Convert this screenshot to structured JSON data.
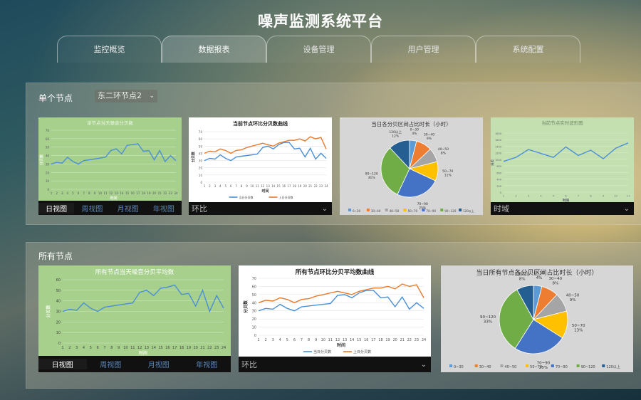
{
  "app": {
    "title": "噪声监测系统平台"
  },
  "tabs": [
    "监控概览",
    "数据报表",
    "设备管理",
    "用户管理",
    "系统配置"
  ],
  "active_tab": 1,
  "single": {
    "heading": "单个节点",
    "select_value": "东二环节点2",
    "charts": {
      "daily": {
        "title": "单节点当天噪音分贝数",
        "xlabel": "时间",
        "ylabel": "分贝数"
      },
      "compare": {
        "title": "当前节点环比分贝数曲线",
        "xlabel": "时间",
        "ylabel": "分贝数",
        "legend": [
          "当日分贝数",
          "上日分贝数"
        ],
        "footer": "环比"
      },
      "pie": {
        "title": "当日各分贝区间占比时长（小时）"
      },
      "wave": {
        "title": "当前节点实时波形图",
        "xlabel": "时间",
        "ylabel": "分贝",
        "footer": "时域"
      }
    },
    "views": [
      "日视图",
      "周视图",
      "月视图",
      "年视图"
    ]
  },
  "all": {
    "heading": "所有节点",
    "charts": {
      "daily": {
        "title": "所有节点当天噪音分贝平均数",
        "xlabel": "时间",
        "ylabel": "分贝数"
      },
      "compare": {
        "title": "所有节点环比分贝平均数曲线",
        "xlabel": "时间",
        "ylabel": "分贝数",
        "legend": [
          "当日分贝数",
          "上日分贝数"
        ],
        "footer": "环比"
      },
      "pie": {
        "title": "当日所有节点各分贝区间占比时长（小时）"
      }
    },
    "views": [
      "日视图",
      "周视图",
      "月视图",
      "年视图"
    ]
  },
  "colors": {
    "blue": "#4a8fd8",
    "orange": "#ea7a2c",
    "green_bg": "#a6d08c",
    "pie": [
      "#5b9bd5",
      "#ed7d31",
      "#a5a5a5",
      "#ffc000",
      "#4472c4",
      "#70ad47",
      "#255e91"
    ]
  },
  "chart_data": [
    {
      "type": "line",
      "title": "单节点当天噪音分贝数",
      "xlabel": "时间",
      "ylabel": "分贝数",
      "ylim": [
        0,
        70
      ],
      "x": [
        1,
        2,
        3,
        4,
        5,
        6,
        7,
        8,
        9,
        10,
        11,
        12,
        13,
        14,
        15,
        16,
        17,
        18,
        19,
        20,
        21,
        22,
        23,
        24
      ],
      "series": [
        {
          "values": [
            30,
            32,
            31,
            38,
            33,
            30,
            34,
            35,
            36,
            37,
            38,
            46,
            48,
            42,
            52,
            53,
            54,
            45,
            46,
            35,
            46,
            33,
            40,
            34
          ]
        }
      ]
    },
    {
      "type": "line",
      "title": "当前节点环比分贝数曲线",
      "xlabel": "时间",
      "ylabel": "分贝数",
      "ylim": [
        0,
        70
      ],
      "x": [
        1,
        2,
        3,
        4,
        5,
        6,
        7,
        8,
        9,
        10,
        11,
        12,
        13,
        14,
        15,
        16,
        17,
        18,
        19,
        20,
        21,
        22,
        23,
        24
      ],
      "series": [
        {
          "name": "当日分贝数",
          "values": [
            30,
            33,
            32,
            38,
            33,
            30,
            35,
            36,
            37,
            38,
            39,
            48,
            50,
            46,
            52,
            55,
            55,
            46,
            47,
            35,
            47,
            32,
            40,
            33
          ]
        },
        {
          "name": "上日分贝数",
          "values": [
            40,
            43,
            42,
            46,
            44,
            40,
            44,
            45,
            48,
            50,
            52,
            54,
            52,
            50,
            54,
            56,
            58,
            58,
            60,
            57,
            63,
            60,
            62,
            46
          ]
        }
      ]
    },
    {
      "type": "pie",
      "title": "当日各分贝区间占比时长（小时）",
      "labels": [
        "0~30",
        "30~40",
        "40~50",
        "50~70",
        "70~90",
        "90~120",
        "120以上"
      ],
      "values": [
        4,
        9,
        8,
        11,
        25,
        31,
        12
      ]
    },
    {
      "type": "line",
      "title": "当前节点实时波形图",
      "xlabel": "时间",
      "ylabel": "分贝",
      "ylim": [
        0,
        1800
      ],
      "x": [
        1,
        2,
        3,
        4,
        5,
        6,
        7,
        8,
        9,
        10,
        11
      ],
      "series": [
        {
          "values": [
            940,
            1060,
            1300,
            1180,
            1060,
            1380,
            1120,
            1280,
            1020,
            1340,
            1500
          ]
        }
      ]
    },
    {
      "type": "line",
      "title": "所有节点当天噪音分贝平均数",
      "xlabel": "时间",
      "ylabel": "分贝数",
      "ylim": [
        0,
        60
      ],
      "x": [
        1,
        2,
        3,
        4,
        5,
        6,
        7,
        8,
        9,
        10,
        11,
        12,
        13,
        14,
        15,
        16,
        17,
        18,
        19,
        20,
        21,
        22,
        23,
        24
      ],
      "series": [
        {
          "values": [
            30,
            32,
            31,
            38,
            33,
            30,
            34,
            35,
            36,
            37,
            38,
            48,
            50,
            45,
            52,
            53,
            55,
            46,
            47,
            35,
            50,
            30,
            45,
            33
          ]
        }
      ]
    },
    {
      "type": "line",
      "title": "所有节点环比分贝平均数曲线",
      "xlabel": "时间",
      "ylabel": "分贝数",
      "ylim": [
        0,
        70
      ],
      "x": [
        1,
        2,
        3,
        4,
        5,
        6,
        7,
        8,
        9,
        10,
        11,
        12,
        13,
        14,
        15,
        16,
        17,
        18,
        19,
        20,
        21,
        22,
        23,
        24
      ],
      "series": [
        {
          "name": "当日分贝数",
          "values": [
            30,
            33,
            32,
            38,
            33,
            30,
            35,
            36,
            37,
            38,
            39,
            49,
            50,
            46,
            52,
            55,
            55,
            46,
            47,
            35,
            47,
            32,
            40,
            33
          ]
        },
        {
          "name": "上日分贝数",
          "values": [
            40,
            43,
            42,
            46,
            44,
            40,
            44,
            45,
            48,
            50,
            52,
            54,
            52,
            50,
            54,
            56,
            58,
            58,
            60,
            57,
            63,
            60,
            62,
            46
          ]
        }
      ]
    },
    {
      "type": "pie",
      "title": "当日所有节点各分贝区间占比时长（小时）",
      "labels": [
        "0~30",
        "30~40",
        "40~50",
        "50~70",
        "70~90",
        "90~120",
        "120以上"
      ],
      "values": [
        4,
        8,
        9,
        13,
        25,
        33,
        8
      ]
    }
  ]
}
